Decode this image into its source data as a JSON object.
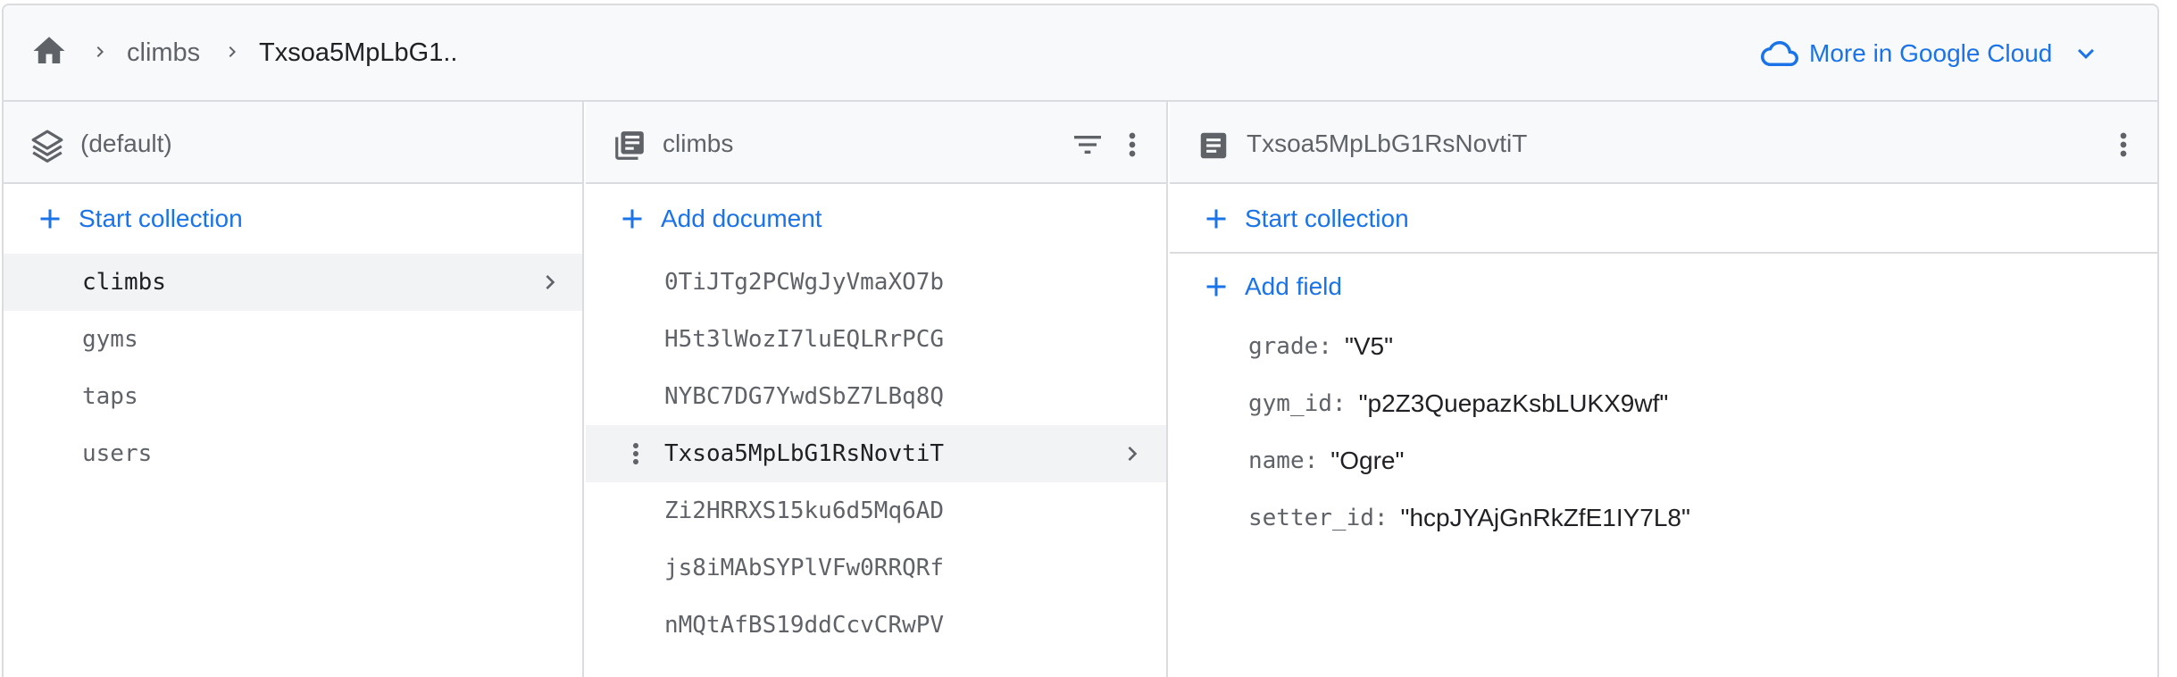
{
  "breadcrumb": {
    "collection": "climbs",
    "document": "Txsoa5MpLbG1.."
  },
  "cloud_link": {
    "label": "More in Google Cloud"
  },
  "colors": {
    "accent": "#1a73e8",
    "selected_row": "#f1f3f4",
    "border": "#dadce0"
  },
  "root_panel": {
    "title": "(default)",
    "action_label": "Start collection",
    "items": [
      "climbs",
      "gyms",
      "taps",
      "users"
    ],
    "selected_index": 0
  },
  "collection_panel": {
    "title": "climbs",
    "action_label": "Add document",
    "items": [
      "0TiJTg2PCWgJyVmaXO7b",
      "H5t3lWozI7luEQLRrPCG",
      "NYBC7DG7YwdSbZ7LBq8Q",
      "Txsoa5MpLbG1RsNovtiT",
      "Zi2HRRXS15ku6d5Mq6AD",
      "js8iMAbSYPlVFw0RRQRf",
      "nMQtAfBS19ddCcvCRwPV"
    ],
    "selected_index": 3
  },
  "document_panel": {
    "title": "Txsoa5MpLbG1RsNovtiT",
    "start_collection_label": "Start collection",
    "add_field_label": "Add field",
    "fields": [
      {
        "key": "grade",
        "value": "\"V5\""
      },
      {
        "key": "gym_id",
        "value": "\"p2Z3QuepazKsbLUKX9wf\""
      },
      {
        "key": "name",
        "value": "\"Ogre\""
      },
      {
        "key": "setter_id",
        "value": "\"hcpJYAjGnRkZfE1IY7L8\""
      }
    ]
  },
  "icons": {
    "home": "home-icon",
    "breadcrumb_separator": "chevron-right-icon",
    "cloud": "cloud-icon",
    "expand": "chevron-down-icon",
    "database": "database-stack-icon",
    "collection": "collection-icon",
    "document": "document-icon",
    "filter": "filter-icon",
    "more": "more-vert-icon",
    "add": "plus-icon"
  }
}
